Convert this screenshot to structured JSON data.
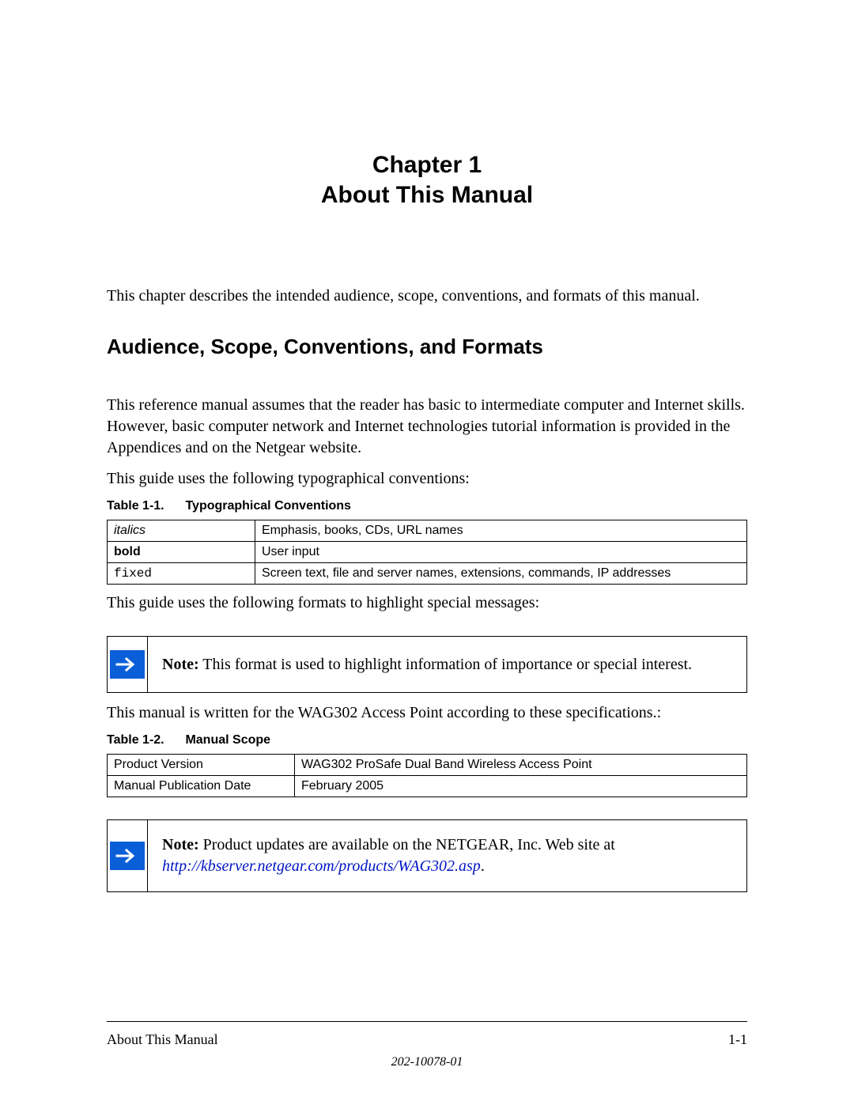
{
  "chapter": {
    "line1": "Chapter 1",
    "line2": "About This Manual"
  },
  "intro": "This chapter describes the intended audience, scope, conventions, and formats of this manual.",
  "section_heading": "Audience, Scope, Conventions, and Formats",
  "para1": "This reference manual assumes that the reader has basic to intermediate computer and Internet skills. However, basic computer network and Internet technologies tutorial information is provided in the Appendices and on the Netgear website.",
  "para2": "This guide uses the following typographical conventions:",
  "table1": {
    "caption_num": "Table 1-1.",
    "caption_title": "Typographical Conventions",
    "rows": [
      {
        "style": "italic",
        "label": "italics",
        "desc": "Emphasis, books, CDs, URL names"
      },
      {
        "style": "bold",
        "label": "bold",
        "desc": "User input"
      },
      {
        "style": "fixed",
        "label": "fixed",
        "desc": "Screen text, file and server names, extensions, commands, IP addresses"
      }
    ]
  },
  "para3": "This guide uses the following formats to highlight special messages:",
  "note1": {
    "prefix": "Note:",
    "text": " This format is used to highlight information of importance or special interest."
  },
  "para4": "This manual is written for the WAG302 Access Point according to these specifications.:",
  "table2": {
    "caption_num": "Table 1-2.",
    "caption_title": "Manual Scope",
    "rows": [
      {
        "label": "Product Version",
        "value": "WAG302 ProSafe Dual Band Wireless Access Point"
      },
      {
        "label": "Manual Publication Date",
        "value": "February 2005"
      }
    ]
  },
  "note2": {
    "prefix": "Note:",
    "text": " Product updates are available on the NETGEAR, Inc. Web site at ",
    "link": "http://kbserver.netgear.com/products/WAG302.asp",
    "suffix": "."
  },
  "footer": {
    "left": "About This Manual",
    "right": "1-1",
    "docnum": "202-10078-01"
  }
}
